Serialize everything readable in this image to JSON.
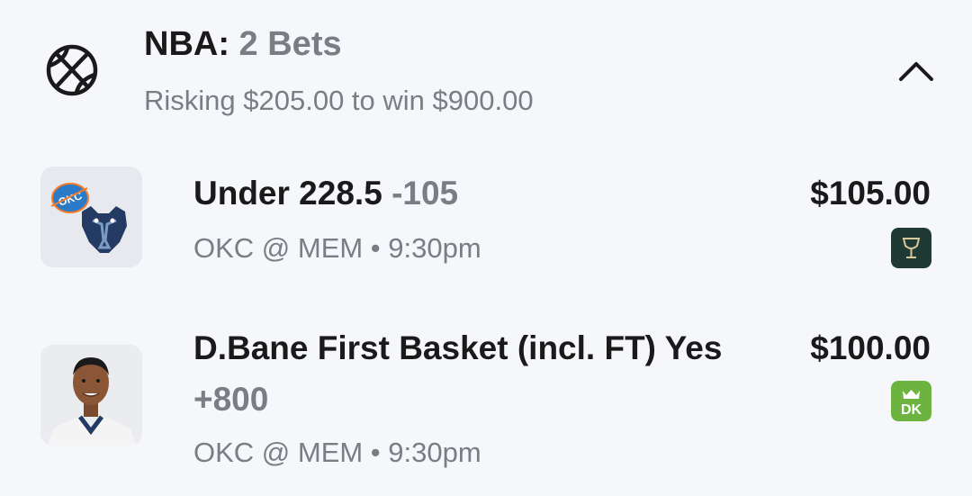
{
  "header": {
    "league": "NBA:",
    "count": "2 Bets",
    "summary": "Risking $205.00 to win $900.00",
    "sport_icon": "basketball-icon",
    "toggle_icon": "chevron-up-icon"
  },
  "bets": [
    {
      "selection": "Under 228.5",
      "odds": "-105",
      "matchup": "OKC @ MEM • 9:30pm",
      "stake": "$105.00",
      "thumbnail": "team-logos-okc-mem",
      "sportsbook_icon": "chalice-sportsbook-icon",
      "sportsbook_color": "#1f3a32"
    },
    {
      "selection": "D.Bane First Basket (incl. FT) Yes",
      "odds": "+800",
      "matchup": "OKC @ MEM • 9:30pm",
      "stake": "$100.00",
      "thumbnail": "player-headshot",
      "sportsbook_icon": "draftkings-icon",
      "sportsbook_color": "#6db33f"
    }
  ],
  "colors": {
    "background": "#f6f7fb",
    "primary_text": "#1a1a1a",
    "secondary_text": "#7b7d85",
    "okc_blue": "#2a7ac7",
    "mem_navy": "#233a63"
  }
}
